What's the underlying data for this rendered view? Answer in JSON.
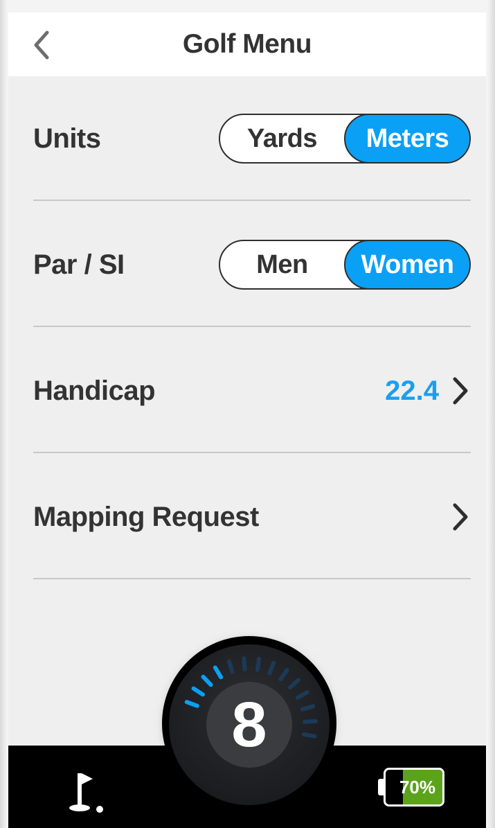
{
  "header": {
    "title": "Golf Menu",
    "back_icon": "chevron-left-icon"
  },
  "rows": {
    "units": {
      "label": "Units",
      "options": [
        "Yards",
        "Meters"
      ],
      "selected": "Meters"
    },
    "par_si": {
      "label": "Par / SI",
      "options": [
        "Men",
        "Women"
      ],
      "selected": "Women"
    },
    "handicap": {
      "label": "Handicap",
      "value": "22.4",
      "icon": "chevron-right-icon"
    },
    "mapping_request": {
      "label": "Mapping Request",
      "icon": "chevron-right-icon"
    }
  },
  "dial": {
    "hole_number": "8",
    "active_ticks": 4,
    "total_ticks": 14
  },
  "bottom_bar": {
    "flag_icon": "golf-flag-icon",
    "battery": {
      "label": "70%",
      "level": 0.7
    }
  },
  "colors": {
    "accent": "#0aa0f5",
    "text": "#333333",
    "background": "#efefef",
    "battery_fill": "#5aa31a"
  }
}
